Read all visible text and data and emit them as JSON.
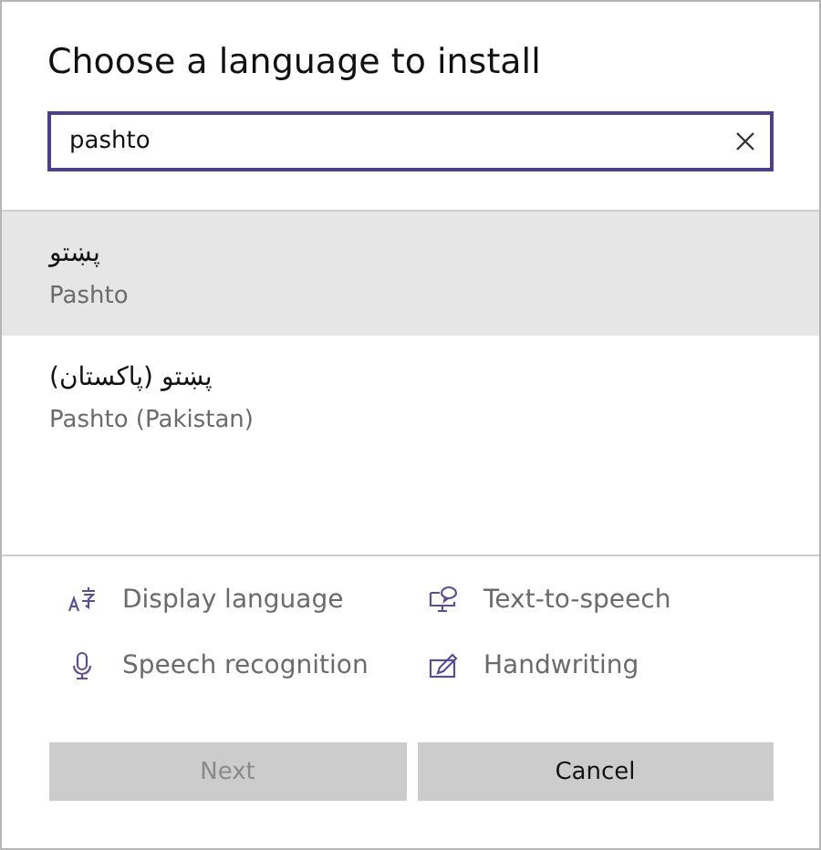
{
  "dialog": {
    "title": "Choose a language to install"
  },
  "search": {
    "value": "pashto"
  },
  "results": [
    {
      "native": "پښتو",
      "name": "Pashto",
      "selected": true
    },
    {
      "native": "پښتو (پاکستان)",
      "name": "Pashto (Pakistan)",
      "selected": false
    }
  ],
  "features": [
    {
      "kind": "display",
      "label": "Display language"
    },
    {
      "kind": "tts",
      "label": "Text-to-speech"
    },
    {
      "kind": "speech",
      "label": "Speech recognition"
    },
    {
      "kind": "handwriting",
      "label": "Handwriting"
    }
  ],
  "buttons": [
    {
      "label": "Next",
      "disabled": true
    },
    {
      "label": "Cancel",
      "disabled": false
    }
  ]
}
